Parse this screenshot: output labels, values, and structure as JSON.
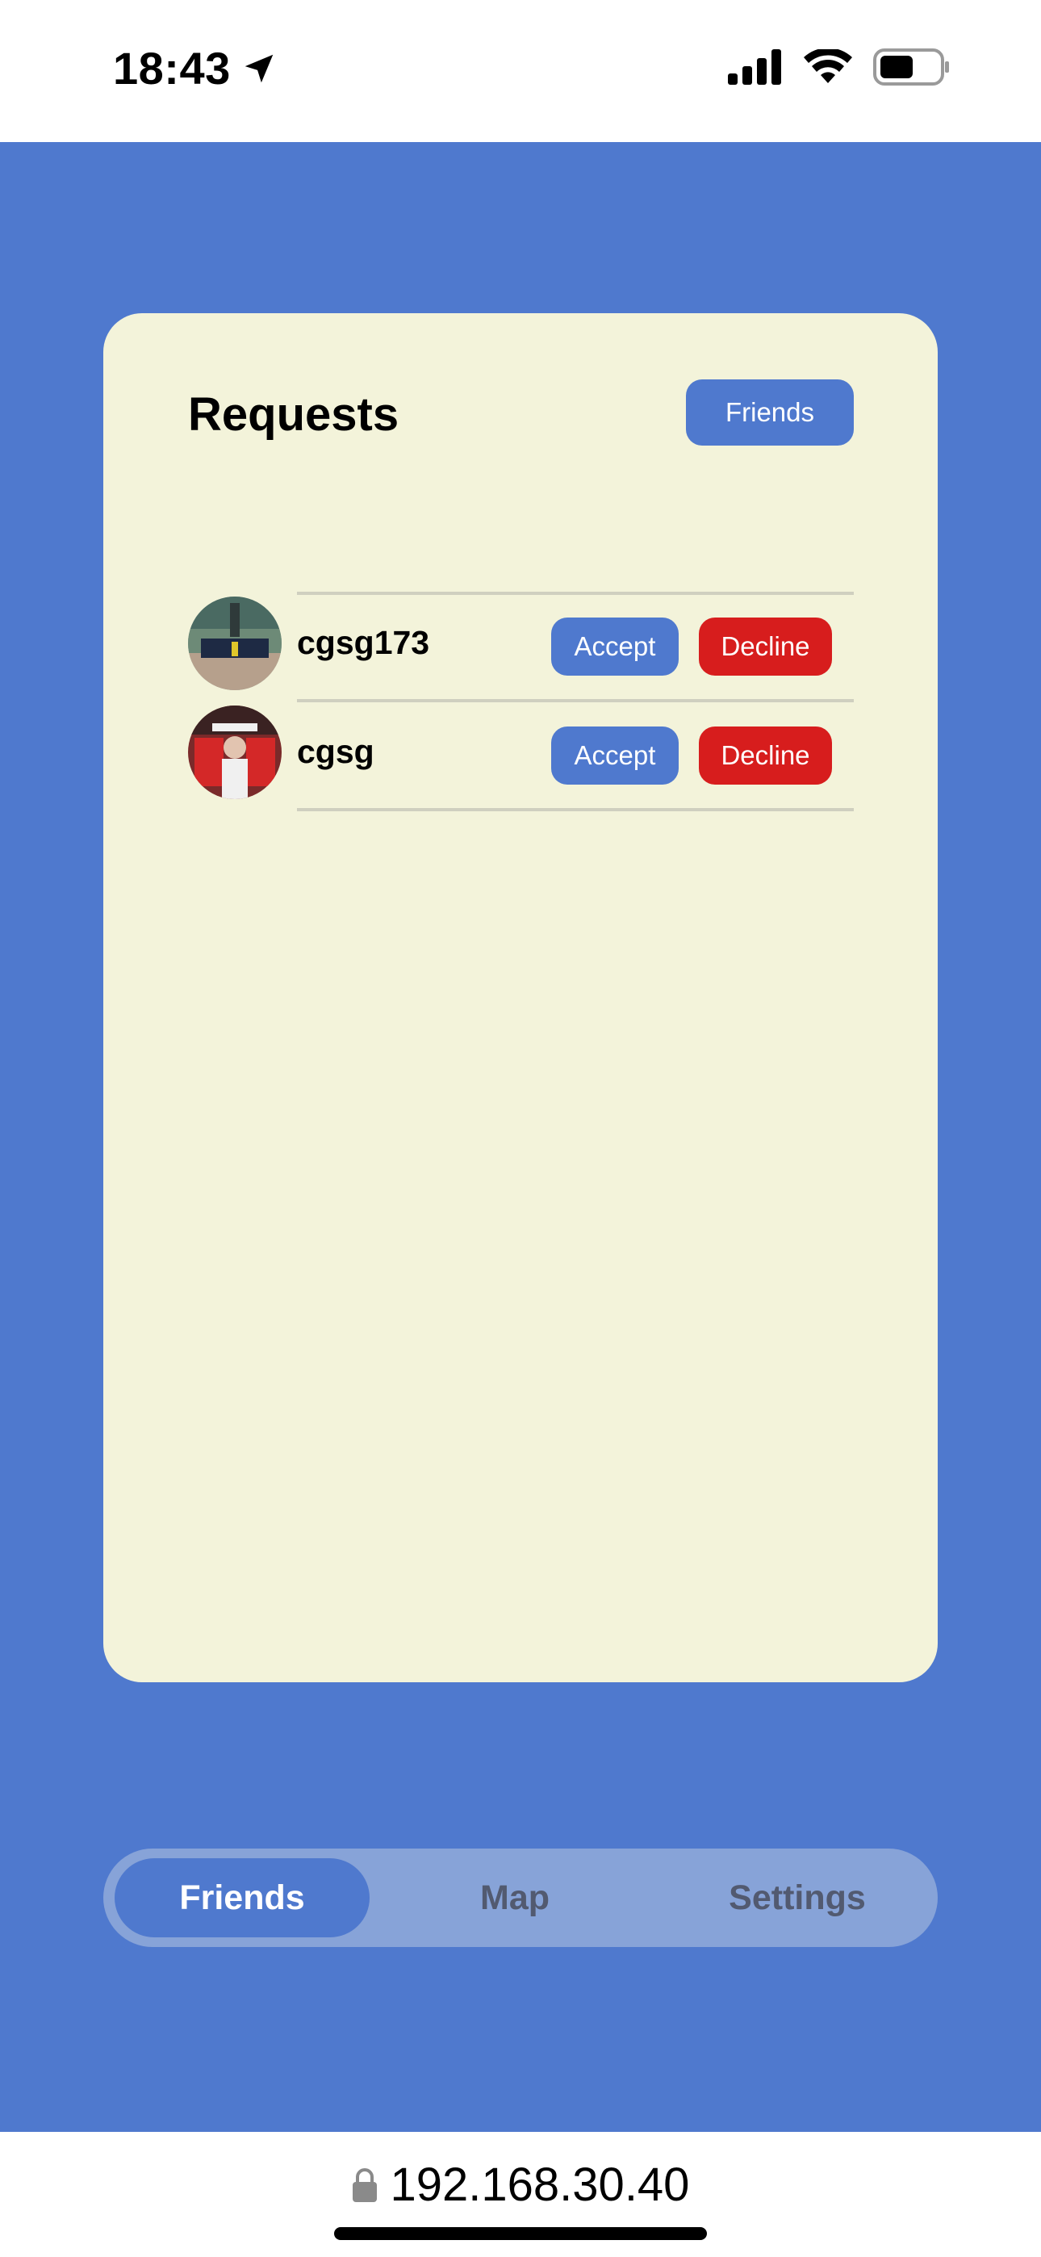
{
  "status_bar": {
    "time": "18:43",
    "icons": [
      "location-arrow-icon",
      "cellular-signal-icon",
      "wifi-icon",
      "battery-icon"
    ]
  },
  "card": {
    "title": "Requests",
    "friends_button": "Friends"
  },
  "requests": [
    {
      "username": "cgsg173",
      "accept_label": "Accept",
      "decline_label": "Decline"
    },
    {
      "username": "cgsg",
      "accept_label": "Accept",
      "decline_label": "Decline"
    }
  ],
  "tab_bar": {
    "tabs": [
      {
        "label": "Friends",
        "active": true
      },
      {
        "label": "Map",
        "active": false
      },
      {
        "label": "Settings",
        "active": false
      }
    ]
  },
  "url_bar": {
    "url": "192.168.30.40",
    "icon": "lock-icon"
  },
  "colors": {
    "background": "#4f79ce",
    "card": "#f3f3da",
    "accept": "#4f79ce",
    "decline": "#d71d1d",
    "tab_bar": "#87a3d8"
  }
}
